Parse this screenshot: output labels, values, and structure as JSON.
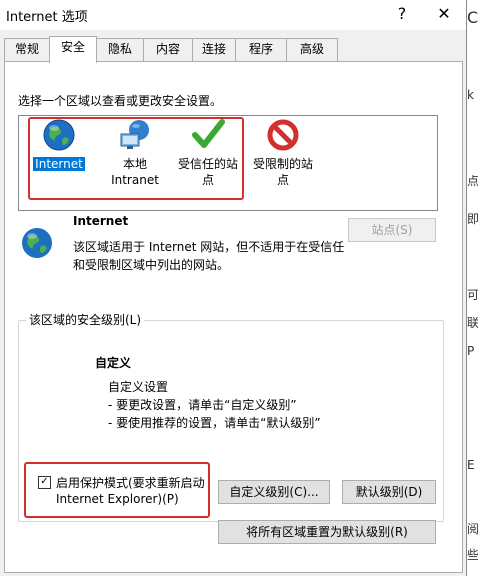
{
  "window": {
    "title": "Internet 选项",
    "help_glyph": "?",
    "close_glyph": "✕"
  },
  "tabs": [
    {
      "label": "常规"
    },
    {
      "label": "安全"
    },
    {
      "label": "隐私"
    },
    {
      "label": "内容"
    },
    {
      "label": "连接"
    },
    {
      "label": "程序"
    },
    {
      "label": "高级"
    }
  ],
  "security": {
    "instruction": "选择一个区域以查看或更改安全设置。",
    "zones": [
      {
        "label": "Internet",
        "icon": "globe-icon",
        "selected": true
      },
      {
        "label_line1": "本地",
        "label_line2": "Intranet",
        "icon": "intranet-icon"
      },
      {
        "label_line1": "受信任的站",
        "label_line2": "点",
        "icon": "checkmark-icon"
      },
      {
        "label_line1": "受限制的站",
        "label_line2": "点",
        "icon": "restricted-icon"
      }
    ],
    "zone_info": {
      "title": "Internet",
      "desc_line1": "该区域适用于 Internet 网站，但不适用于在受信任",
      "desc_line2": "和受限制区域中列出的网站。",
      "sites_button": "站点(S)"
    },
    "level_group": {
      "title": "该区域的安全级别(L)",
      "level_name": "自定义",
      "custom_line1": "自定义设置",
      "custom_line2": "- 要更改设置，请单击“自定义级别”",
      "custom_line3": "- 要使用推荐的设置，请单击“默认级别”",
      "protected_mode_line1": "启用保护模式(要求重新启动",
      "protected_mode_line2": "Internet Explorer)(P)",
      "protected_mode_checked": true,
      "custom_level_button": "自定义级别(C)...",
      "default_level_button": "默认级别(D)"
    },
    "reset_all_button": "将所有区域重置为默认级别(R)"
  },
  "colors": {
    "highlight": "#d32f2f",
    "selection": "#0078d7"
  },
  "background_strip": [
    "C",
    "k",
    "点",
    "即",
    "可",
    "联",
    "P",
    "E",
    "阅",
    "些"
  ]
}
